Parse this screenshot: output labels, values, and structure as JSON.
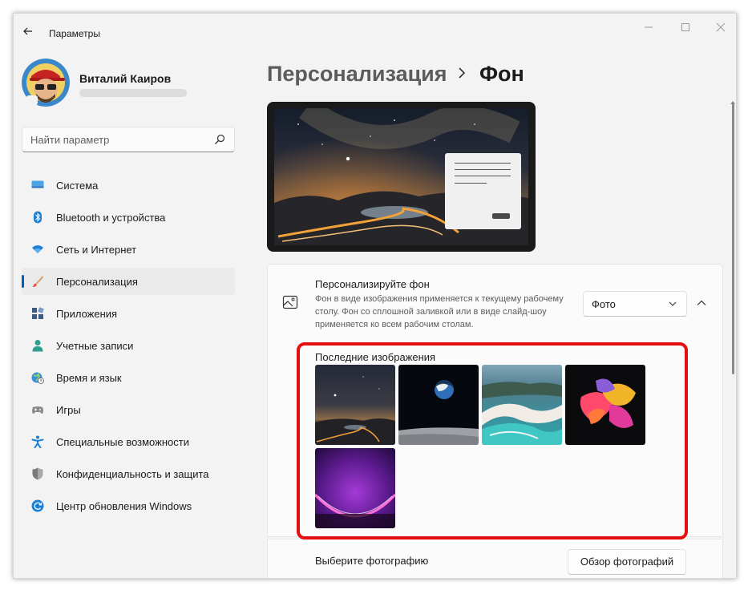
{
  "window": {
    "title": "Параметры"
  },
  "user": {
    "name": "Виталий Каиров"
  },
  "search": {
    "placeholder": "Найти параметр"
  },
  "sidebar": {
    "items": [
      {
        "label": "Система",
        "icon": "monitor-icon",
        "active": false
      },
      {
        "label": "Bluetooth и устройства",
        "icon": "bluetooth-icon",
        "active": false
      },
      {
        "label": "Сеть и Интернет",
        "icon": "wifi-icon",
        "active": false
      },
      {
        "label": "Персонализация",
        "icon": "brush-icon",
        "active": true
      },
      {
        "label": "Приложения",
        "icon": "apps-icon",
        "active": false
      },
      {
        "label": "Учетные записи",
        "icon": "person-icon",
        "active": false
      },
      {
        "label": "Время и язык",
        "icon": "globe-clock-icon",
        "active": false
      },
      {
        "label": "Игры",
        "icon": "gamepad-icon",
        "active": false
      },
      {
        "label": "Специальные возможности",
        "icon": "accessibility-icon",
        "active": false
      },
      {
        "label": "Конфиденциальность и защита",
        "icon": "shield-icon",
        "active": false
      },
      {
        "label": "Центр обновления Windows",
        "icon": "update-icon",
        "active": false
      }
    ]
  },
  "breadcrumb": {
    "parent": "Персонализация",
    "separator": "›",
    "current": "Фон"
  },
  "background_card": {
    "title": "Персонализируйте фон",
    "description": "Фон в виде изображения применяется к текущему рабочему столу. Фон со сплошной заливкой или в виде слайд-шоу применяется ко всем рабочим столам.",
    "dropdown_value": "Фото",
    "expanded": true
  },
  "recent_images": {
    "label": "Последние изображения",
    "images": [
      "night-sky-road-thumbnail",
      "earth-from-moon-thumbnail",
      "tropical-beach-thumbnail",
      "abstract-petals-thumbnail",
      "purple-bloom-thumbnail"
    ]
  },
  "choose_photo": {
    "label": "Выберите фотографию",
    "button_label": "Обзор фотографий"
  },
  "colors": {
    "accent": "#005fb8",
    "highlight": "#e60f0f"
  }
}
